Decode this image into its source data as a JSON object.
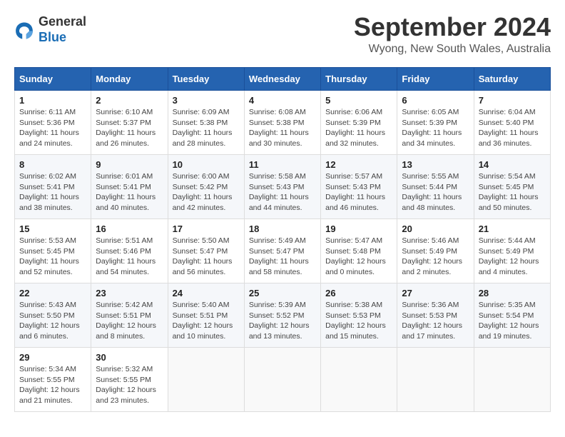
{
  "logo": {
    "general": "General",
    "blue": "Blue"
  },
  "title": "September 2024",
  "location": "Wyong, New South Wales, Australia",
  "days_header": [
    "Sunday",
    "Monday",
    "Tuesday",
    "Wednesday",
    "Thursday",
    "Friday",
    "Saturday"
  ],
  "weeks": [
    [
      {
        "day": "1",
        "sunrise": "6:11 AM",
        "sunset": "5:36 PM",
        "daylight": "11 hours and 24 minutes."
      },
      {
        "day": "2",
        "sunrise": "6:10 AM",
        "sunset": "5:37 PM",
        "daylight": "11 hours and 26 minutes."
      },
      {
        "day": "3",
        "sunrise": "6:09 AM",
        "sunset": "5:38 PM",
        "daylight": "11 hours and 28 minutes."
      },
      {
        "day": "4",
        "sunrise": "6:08 AM",
        "sunset": "5:38 PM",
        "daylight": "11 hours and 30 minutes."
      },
      {
        "day": "5",
        "sunrise": "6:06 AM",
        "sunset": "5:39 PM",
        "daylight": "11 hours and 32 minutes."
      },
      {
        "day": "6",
        "sunrise": "6:05 AM",
        "sunset": "5:39 PM",
        "daylight": "11 hours and 34 minutes."
      },
      {
        "day": "7",
        "sunrise": "6:04 AM",
        "sunset": "5:40 PM",
        "daylight": "11 hours and 36 minutes."
      }
    ],
    [
      {
        "day": "8",
        "sunrise": "6:02 AM",
        "sunset": "5:41 PM",
        "daylight": "11 hours and 38 minutes."
      },
      {
        "day": "9",
        "sunrise": "6:01 AM",
        "sunset": "5:41 PM",
        "daylight": "11 hours and 40 minutes."
      },
      {
        "day": "10",
        "sunrise": "6:00 AM",
        "sunset": "5:42 PM",
        "daylight": "11 hours and 42 minutes."
      },
      {
        "day": "11",
        "sunrise": "5:58 AM",
        "sunset": "5:43 PM",
        "daylight": "11 hours and 44 minutes."
      },
      {
        "day": "12",
        "sunrise": "5:57 AM",
        "sunset": "5:43 PM",
        "daylight": "11 hours and 46 minutes."
      },
      {
        "day": "13",
        "sunrise": "5:55 AM",
        "sunset": "5:44 PM",
        "daylight": "11 hours and 48 minutes."
      },
      {
        "day": "14",
        "sunrise": "5:54 AM",
        "sunset": "5:45 PM",
        "daylight": "11 hours and 50 minutes."
      }
    ],
    [
      {
        "day": "15",
        "sunrise": "5:53 AM",
        "sunset": "5:45 PM",
        "daylight": "11 hours and 52 minutes."
      },
      {
        "day": "16",
        "sunrise": "5:51 AM",
        "sunset": "5:46 PM",
        "daylight": "11 hours and 54 minutes."
      },
      {
        "day": "17",
        "sunrise": "5:50 AM",
        "sunset": "5:47 PM",
        "daylight": "11 hours and 56 minutes."
      },
      {
        "day": "18",
        "sunrise": "5:49 AM",
        "sunset": "5:47 PM",
        "daylight": "11 hours and 58 minutes."
      },
      {
        "day": "19",
        "sunrise": "5:47 AM",
        "sunset": "5:48 PM",
        "daylight": "12 hours and 0 minutes."
      },
      {
        "day": "20",
        "sunrise": "5:46 AM",
        "sunset": "5:49 PM",
        "daylight": "12 hours and 2 minutes."
      },
      {
        "day": "21",
        "sunrise": "5:44 AM",
        "sunset": "5:49 PM",
        "daylight": "12 hours and 4 minutes."
      }
    ],
    [
      {
        "day": "22",
        "sunrise": "5:43 AM",
        "sunset": "5:50 PM",
        "daylight": "12 hours and 6 minutes."
      },
      {
        "day": "23",
        "sunrise": "5:42 AM",
        "sunset": "5:51 PM",
        "daylight": "12 hours and 8 minutes."
      },
      {
        "day": "24",
        "sunrise": "5:40 AM",
        "sunset": "5:51 PM",
        "daylight": "12 hours and 10 minutes."
      },
      {
        "day": "25",
        "sunrise": "5:39 AM",
        "sunset": "5:52 PM",
        "daylight": "12 hours and 13 minutes."
      },
      {
        "day": "26",
        "sunrise": "5:38 AM",
        "sunset": "5:53 PM",
        "daylight": "12 hours and 15 minutes."
      },
      {
        "day": "27",
        "sunrise": "5:36 AM",
        "sunset": "5:53 PM",
        "daylight": "12 hours and 17 minutes."
      },
      {
        "day": "28",
        "sunrise": "5:35 AM",
        "sunset": "5:54 PM",
        "daylight": "12 hours and 19 minutes."
      }
    ],
    [
      {
        "day": "29",
        "sunrise": "5:34 AM",
        "sunset": "5:55 PM",
        "daylight": "12 hours and 21 minutes."
      },
      {
        "day": "30",
        "sunrise": "5:32 AM",
        "sunset": "5:55 PM",
        "daylight": "12 hours and 23 minutes."
      },
      null,
      null,
      null,
      null,
      null
    ]
  ]
}
